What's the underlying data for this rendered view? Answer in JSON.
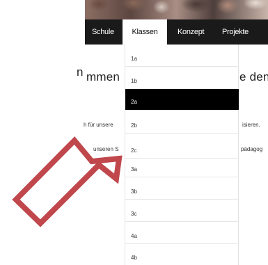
{
  "nav": {
    "items": [
      {
        "label": "Schule",
        "active": false
      },
      {
        "label": "Klassen",
        "active": true
      },
      {
        "label": "Konzept",
        "active": false
      },
      {
        "label": "Projekte",
        "active": false
      }
    ]
  },
  "page_fragments": {
    "left_heading": "n",
    "heading_middle": "mmen",
    "heading_right": "e den",
    "line1_left": "h für unsere",
    "line1_right": "isieren.",
    "line2_left": "unseren S",
    "line2_right": "pädagog"
  },
  "dropdown": {
    "items": [
      {
        "label": "1a",
        "active": false
      },
      {
        "label": "1b",
        "active": false
      },
      {
        "label": "2a",
        "active": true
      },
      {
        "label": "2b",
        "active": false
      },
      {
        "label": "2c",
        "active": false
      },
      {
        "label": "3a",
        "active": false
      },
      {
        "label": "3b",
        "active": false
      },
      {
        "label": "3c",
        "active": false
      },
      {
        "label": "4a",
        "active": false
      },
      {
        "label": "4b",
        "active": false
      }
    ]
  },
  "colors": {
    "nav_background": "#1a1a1a",
    "active_item_background": "#000000",
    "arrow_fill": "#ffffff",
    "arrow_stroke": "#c0474c"
  },
  "annotation": {
    "icon": "arrow-up-right-icon"
  }
}
